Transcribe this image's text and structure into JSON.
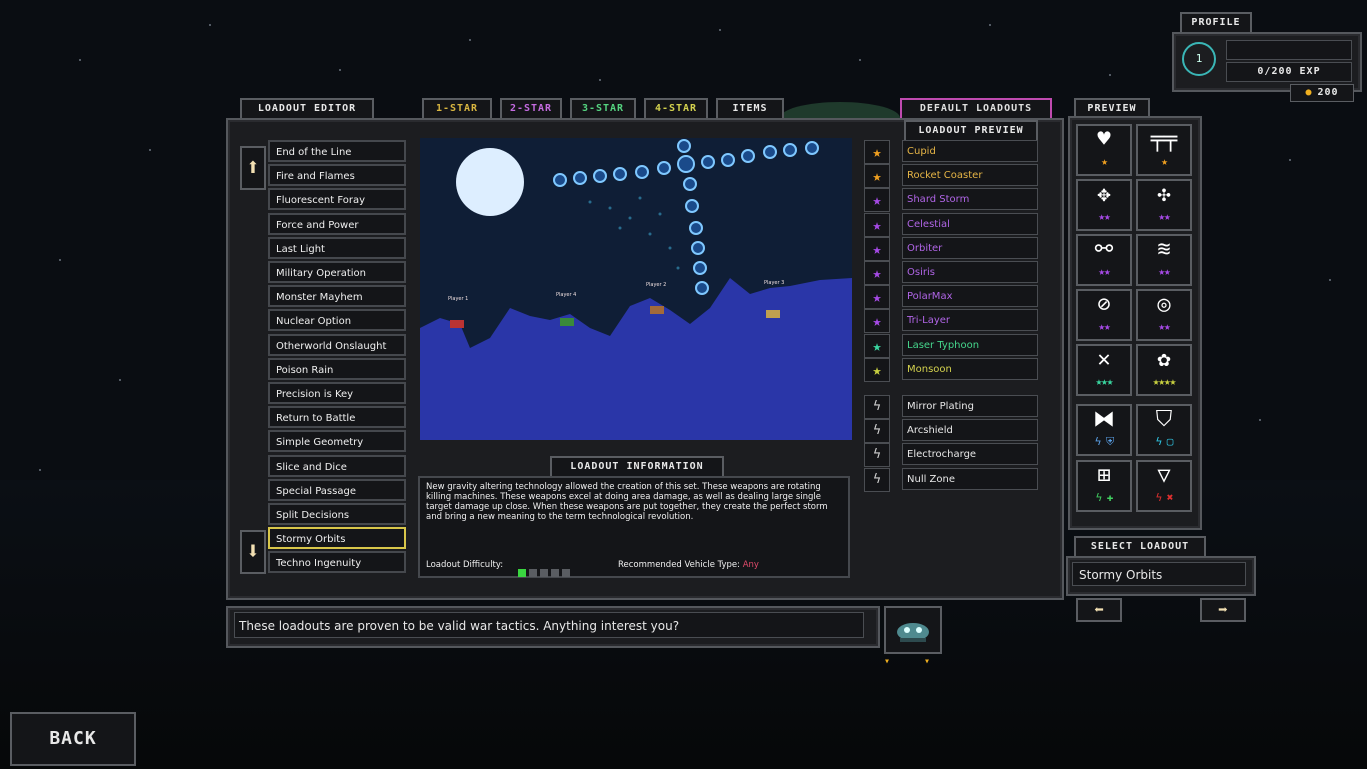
{
  "profile": {
    "tab_label": "PROFILE",
    "level": "1",
    "exp": "0/200 EXP",
    "coins": "200"
  },
  "editor": {
    "tab_label": "LOADOUT EDITOR",
    "star_tabs": [
      "1-STAR",
      "2-STAR",
      "3-STAR",
      "4-STAR",
      "ITEMS"
    ],
    "star_tab_colors": [
      "#d9b640",
      "#c46be0",
      "#55d480",
      "#d4d24e",
      "#e8e8e8"
    ],
    "loadouts": [
      "End of the Line",
      "Fire and Flames",
      "Fluorescent Foray",
      "Force and Power",
      "Last Light",
      "Military Operation",
      "Monster Mayhem",
      "Nuclear Option",
      "Otherworld Onslaught",
      "Poison Rain",
      "Precision is Key",
      "Return to Battle",
      "Simple Geometry",
      "Slice and Dice",
      "Special Passage",
      "Split Decisions",
      "Stormy Orbits",
      "Techno Ingenuity"
    ],
    "selected_index": 16,
    "up_arrow": "⬆",
    "down_arrow": "⬇"
  },
  "preview_scene": {
    "player_labels": [
      "Player 1",
      "Player 4",
      "Player 2",
      "Player 3"
    ]
  },
  "info": {
    "title": "LOADOUT INFORMATION",
    "description": "New gravity altering technology allowed the creation of this set. These weapons are rotating killing machines. These weapons excel at doing area damage, as well as dealing large single target damage up close. When these weapons are put together, they create the perfect storm and bring a new meaning to the term technological revolution.",
    "difficulty_label": "Loadout Difficulty:",
    "difficulty_level": 1,
    "difficulty_max": 5,
    "vehicle_label": "Recommended Vehicle Type:",
    "vehicle_value": "Any"
  },
  "default_loadouts": {
    "tab_label": "DEFAULT LOADOUTS",
    "preview_label": "LOADOUT PREVIEW",
    "weapons": [
      {
        "name": "Cupid",
        "color": "#e6b546",
        "star": "#f0a020"
      },
      {
        "name": "Rocket Coaster",
        "color": "#e6b546",
        "star": "#f0a020"
      },
      {
        "name": "Shard Storm",
        "color": "#b065e6",
        "star": "#a64ae6"
      },
      {
        "name": "Celestial",
        "color": "#b065e6",
        "star": "#a64ae6"
      },
      {
        "name": "Orbiter",
        "color": "#b065e6",
        "star": "#a64ae6"
      },
      {
        "name": "Osiris",
        "color": "#b065e6",
        "star": "#a64ae6"
      },
      {
        "name": "PolarMax",
        "color": "#b065e6",
        "star": "#a64ae6"
      },
      {
        "name": "Tri-Layer",
        "color": "#b065e6",
        "star": "#a64ae6"
      },
      {
        "name": "Laser Typhoon",
        "color": "#45d68c",
        "star": "#3ad6a0"
      },
      {
        "name": "Monsoon",
        "color": "#d4d24e",
        "star": "#c8d040"
      }
    ],
    "items": [
      "Mirror Plating",
      "Arcshield",
      "Electrocharge",
      "Null Zone"
    ],
    "bolt": "ϟ"
  },
  "preview": {
    "tab_label": "PREVIEW",
    "cells": [
      {
        "icon": "♥",
        "icon_name": "heart-icon",
        "stars": "★",
        "star_color": "#f0a020"
      },
      {
        "icon": "╤╤",
        "icon_name": "rocket-coaster-icon",
        "stars": "★",
        "star_color": "#f0a020"
      },
      {
        "icon": "✥",
        "icon_name": "shard-storm-icon",
        "stars": "★★",
        "star_color": "#a64ae6"
      },
      {
        "icon": "✣",
        "icon_name": "celestial-icon",
        "stars": "★★",
        "star_color": "#a64ae6"
      },
      {
        "icon": "⚯",
        "icon_name": "orbiter-icon",
        "stars": "★★",
        "star_color": "#a64ae6"
      },
      {
        "icon": "≋",
        "icon_name": "osiris-icon",
        "stars": "★★",
        "star_color": "#a64ae6"
      },
      {
        "icon": "⊘",
        "icon_name": "polarmax-icon",
        "stars": "★★",
        "star_color": "#a64ae6"
      },
      {
        "icon": "◎",
        "icon_name": "tri-layer-icon",
        "stars": "★★",
        "star_color": "#a64ae6"
      },
      {
        "icon": "✕",
        "icon_name": "laser-typhoon-icon",
        "stars": "★★★",
        "star_color": "#3ad6a0"
      },
      {
        "icon": "✿",
        "icon_name": "monsoon-icon",
        "stars": "★★★★",
        "star_color": "#c8d040"
      },
      {
        "icon": "⧓",
        "icon_name": "mirror-plating-icon",
        "stars": "ϟ ⛨",
        "star_color": "#5aa0e6"
      },
      {
        "icon": "⛉",
        "icon_name": "arcshield-icon",
        "stars": "ϟ ▢",
        "star_color": "#30c8e6"
      },
      {
        "icon": "⊞",
        "icon_name": "electrocharge-icon",
        "stars": "ϟ ✚",
        "star_color": "#40d060"
      },
      {
        "icon": "▽",
        "icon_name": "null-zone-icon",
        "stars": "ϟ ✖",
        "star_color": "#e03030"
      }
    ]
  },
  "select": {
    "tab_label": "SELECT LOADOUT",
    "value": "Stormy Orbits",
    "left": "⬅",
    "right": "➡"
  },
  "dialog": {
    "text": "These loadouts are proven to be valid war tactics. Anything interest you?"
  },
  "back_label": "BACK"
}
